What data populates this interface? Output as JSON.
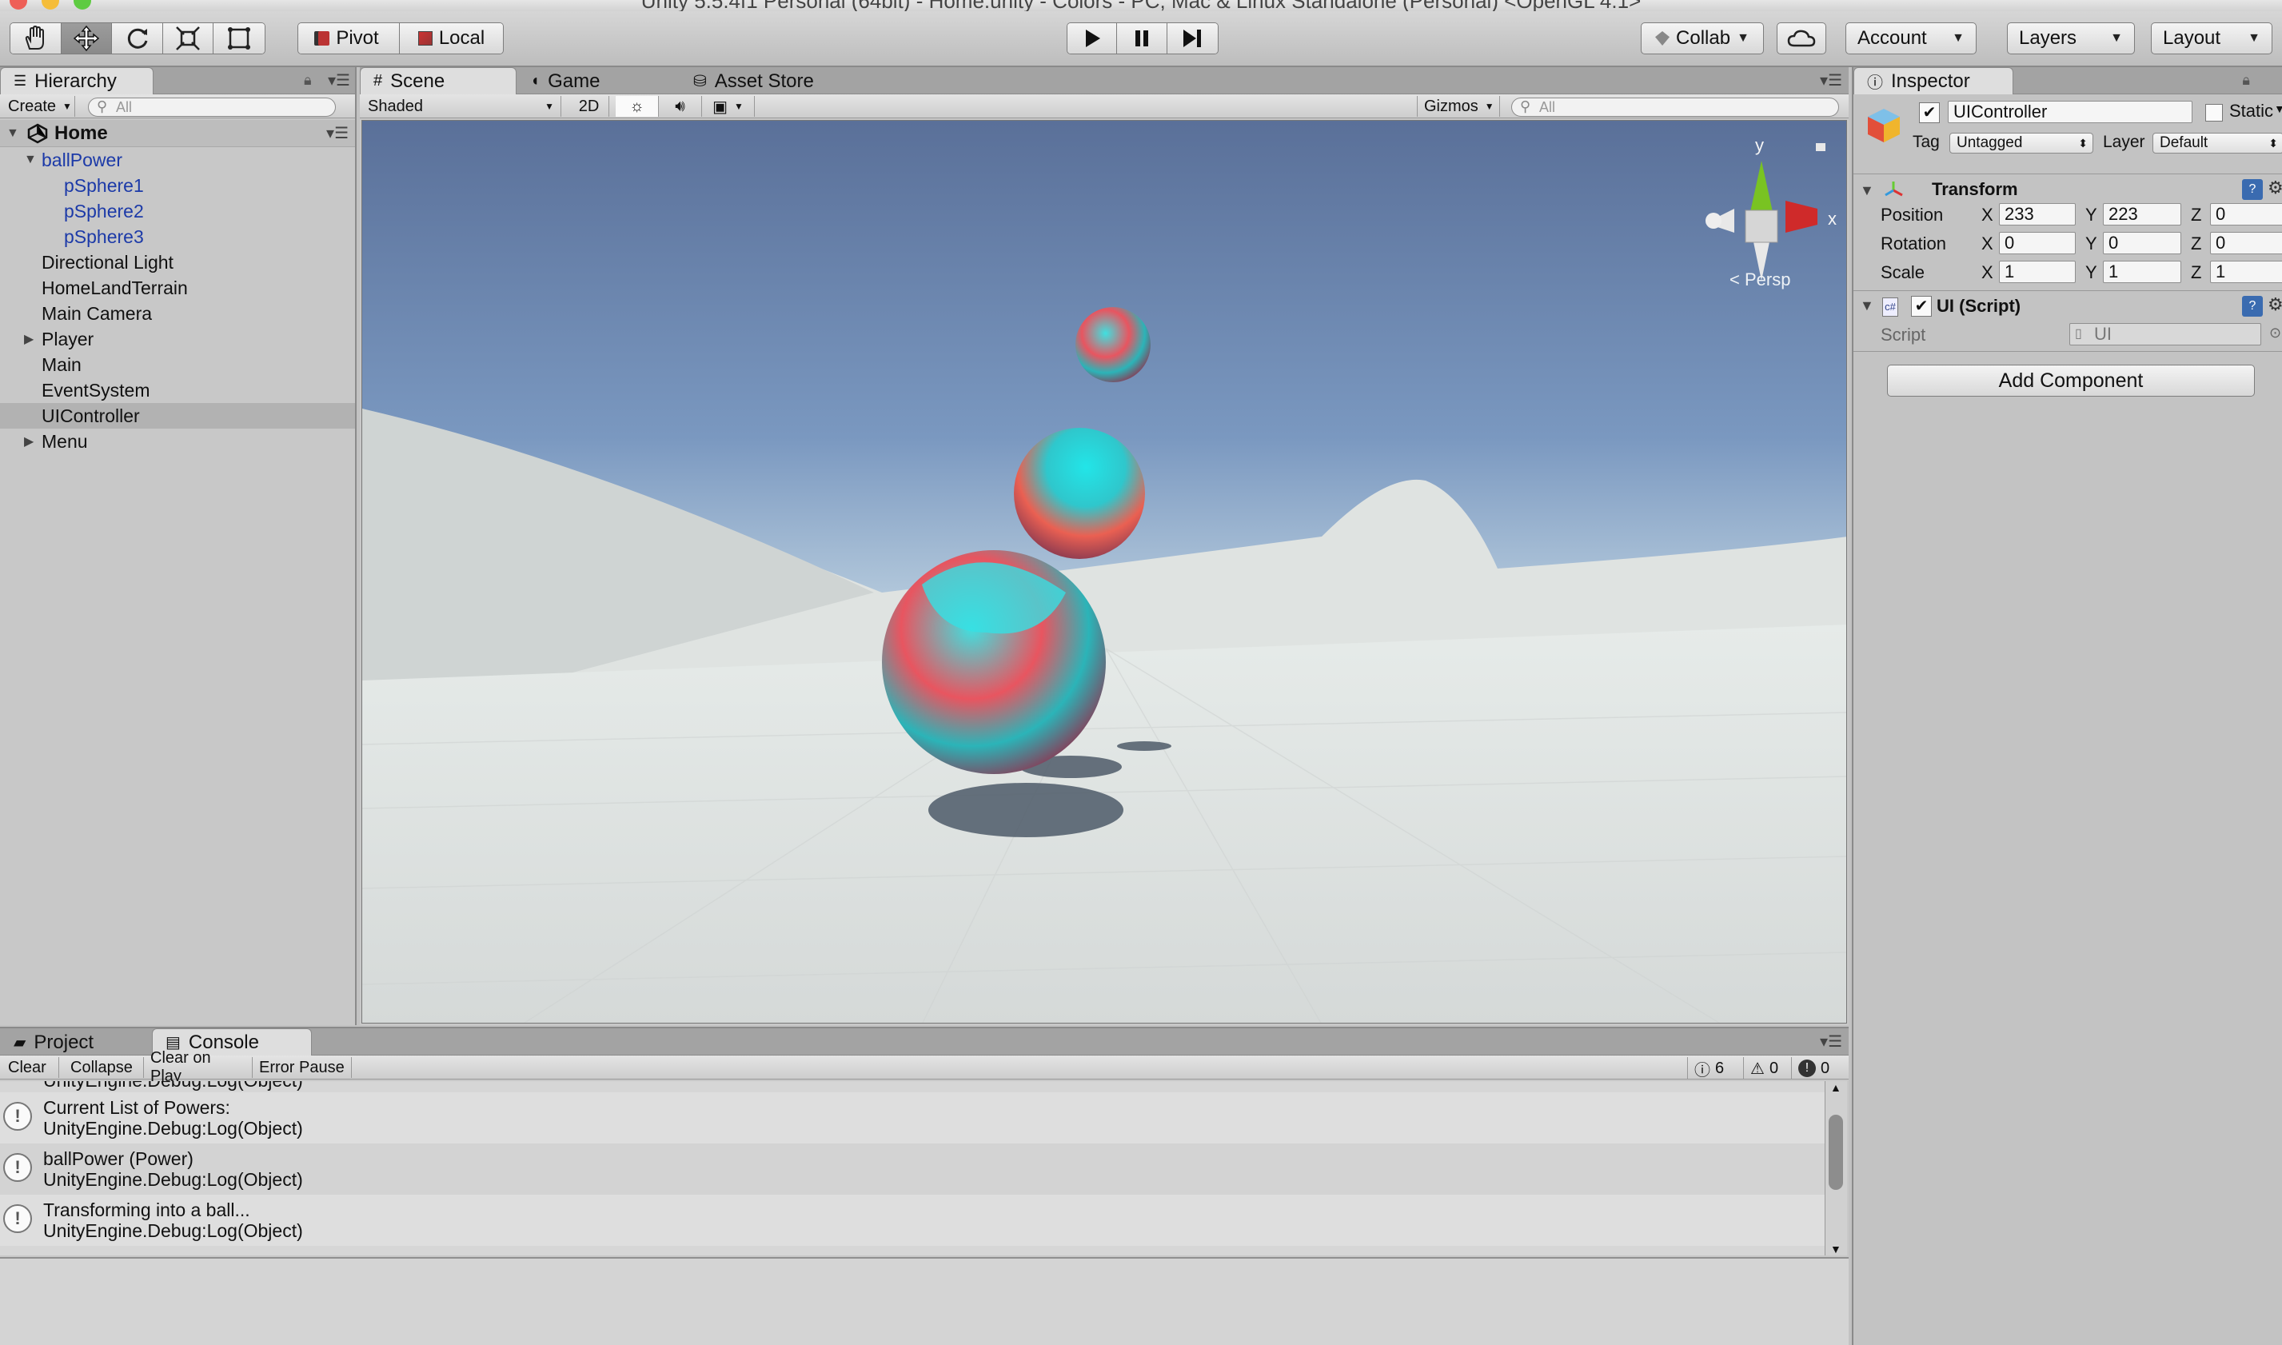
{
  "window": {
    "title": "Unity 5.5.4f1 Personal (64bit) - Home.unity - Colors - PC, Mac & Linux Standalone (Personal) <OpenGL 4.1>"
  },
  "toolbar": {
    "pivot": "Pivot",
    "local": "Local",
    "collab": "Collab",
    "account": "Account",
    "layers": "Layers",
    "layout": "Layout",
    "transform_tools": [
      "hand-tool-icon",
      "move-tool-icon",
      "rotate-tool-icon",
      "scale-tool-icon",
      "rect-tool-icon"
    ],
    "active_tool": "move-tool-icon"
  },
  "hierarchy": {
    "tab": "Hierarchy",
    "create": "Create",
    "search_placeholder": "All",
    "scene": "Home",
    "items": [
      {
        "label": "ballPower",
        "depth": 0,
        "expanded": true,
        "prefab": true
      },
      {
        "label": "pSphere1",
        "depth": 1,
        "prefab": true
      },
      {
        "label": "pSphere2",
        "depth": 1,
        "prefab": true
      },
      {
        "label": "pSphere3",
        "depth": 1,
        "prefab": true
      },
      {
        "label": "Directional Light",
        "depth": 0
      },
      {
        "label": "HomeLandTerrain",
        "depth": 0
      },
      {
        "label": "Main Camera",
        "depth": 0
      },
      {
        "label": "Player",
        "depth": 0,
        "collapsed": true
      },
      {
        "label": "Main",
        "depth": 0
      },
      {
        "label": "EventSystem",
        "depth": 0
      },
      {
        "label": "UIController",
        "depth": 0,
        "selected": true
      },
      {
        "label": "Menu",
        "depth": 0,
        "collapsed": true
      }
    ]
  },
  "scene_view": {
    "tabs": [
      "Scene",
      "Game",
      "Asset Store"
    ],
    "shading": "Shaded",
    "mode_2d": "2D",
    "gizmos": "Gizmos",
    "search_placeholder": "All",
    "axis_y": "y",
    "axis_x": "x",
    "persp": "Persp"
  },
  "inspector": {
    "tab": "Inspector",
    "object_name": "UIController",
    "static_label": "Static",
    "tag_label": "Tag",
    "tag_value": "Untagged",
    "layer_label": "Layer",
    "layer_value": "Default",
    "transform": {
      "title": "Transform",
      "position_label": "Position",
      "rotation_label": "Rotation",
      "scale_label": "Scale",
      "position": {
        "x": "233",
        "y": "223",
        "z": "0"
      },
      "rotation": {
        "x": "0",
        "y": "0",
        "z": "0"
      },
      "scale": {
        "x": "1",
        "y": "1",
        "z": "1"
      }
    },
    "script_component": {
      "title": "UI (Script)",
      "script_label": "Script",
      "script_value": "UI"
    },
    "add_component": "Add Component",
    "axis": {
      "x": "X",
      "y": "Y",
      "z": "Z"
    }
  },
  "bottom": {
    "tabs": [
      "Project",
      "Console"
    ],
    "buttons": [
      "Clear",
      "Collapse",
      "Clear on Play",
      "Error Pause"
    ],
    "counts": {
      "log": "6",
      "warn": "0",
      "error": "0"
    },
    "partial_top": "UnityEngine.Debug:Log(Object)",
    "messages": [
      {
        "line1": "Current List of Powers:",
        "line2": "UnityEngine.Debug:Log(Object)"
      },
      {
        "line1": "ballPower (Power)",
        "line2": "UnityEngine.Debug:Log(Object)"
      },
      {
        "line1": "Transforming into a ball...",
        "line2": "UnityEngine.Debug:Log(Object)"
      }
    ]
  }
}
